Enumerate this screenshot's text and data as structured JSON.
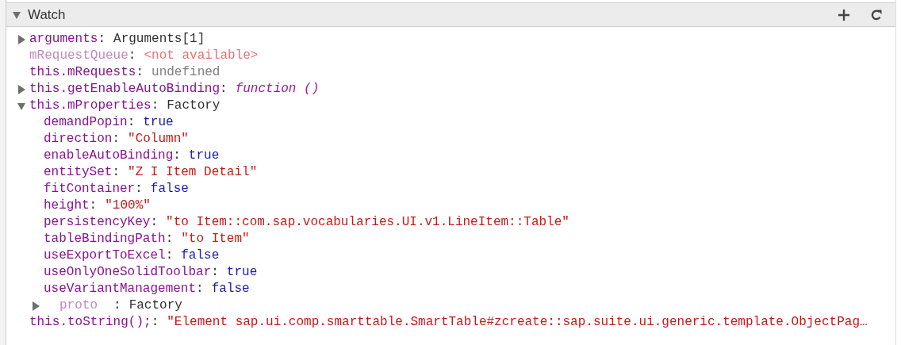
{
  "section": {
    "title": "Watch",
    "expanded": true
  },
  "entries": [
    {
      "name": "arguments",
      "separator": ":",
      "value": "Arguments[1]",
      "kind": "object",
      "expanded": false,
      "dim": false
    },
    {
      "name": "mRequestQueue",
      "separator": ":",
      "value": "<not available>",
      "kind": "unavailable",
      "dim": true
    },
    {
      "name": "this.mRequests",
      "separator": ":",
      "value": "undefined",
      "kind": "undefined",
      "dim": false
    },
    {
      "name": "this.getEnableAutoBinding",
      "separator": ":",
      "value": "function ()",
      "kind": "function",
      "expanded": false,
      "dim": false
    },
    {
      "name": "this.mProperties",
      "separator": ":",
      "value": "Factory",
      "kind": "object",
      "expanded": true,
      "dim": false,
      "children": [
        {
          "name": "demandPopin",
          "separator": ":",
          "value": "true",
          "kind": "keyword",
          "dim": false
        },
        {
          "name": "direction",
          "separator": ":",
          "value": "\"Column\"",
          "kind": "string",
          "dim": false
        },
        {
          "name": "enableAutoBinding",
          "separator": ":",
          "value": "true",
          "kind": "keyword",
          "dim": false
        },
        {
          "name": "entitySet",
          "separator": ":",
          "value": "\"Z I Item Detail\"",
          "kind": "string",
          "dim": false
        },
        {
          "name": "fitContainer",
          "separator": ":",
          "value": "false",
          "kind": "keyword",
          "dim": false
        },
        {
          "name": "height",
          "separator": ":",
          "value": "\"100%\"",
          "kind": "string",
          "dim": false
        },
        {
          "name": "persistencyKey",
          "separator": ":",
          "value": "\"to Item::com.sap.vocabularies.UI.v1.LineItem::Table\"",
          "kind": "string",
          "dim": false
        },
        {
          "name": "tableBindingPath",
          "separator": ":",
          "value": "\"to Item\"",
          "kind": "string",
          "dim": false
        },
        {
          "name": "useExportToExcel",
          "separator": ":",
          "value": "false",
          "kind": "keyword",
          "dim": false
        },
        {
          "name": "useOnlyOneSolidToolbar",
          "separator": ":",
          "value": "true",
          "kind": "keyword",
          "dim": false
        },
        {
          "name": "useVariantManagement",
          "separator": ":",
          "value": "false",
          "kind": "keyword",
          "dim": false
        },
        {
          "name": "proto",
          "separator": ":",
          "value": "Factory",
          "kind": "object",
          "expanded": false,
          "dim": true
        }
      ]
    },
    {
      "name": "this.toString();",
      "separator": ":",
      "value": "\"Element sap.ui.comp.smarttable.SmartTable#zcreate::sap.suite.ui.generic.template.ObjectPag…",
      "kind": "string",
      "dim": false
    }
  ]
}
